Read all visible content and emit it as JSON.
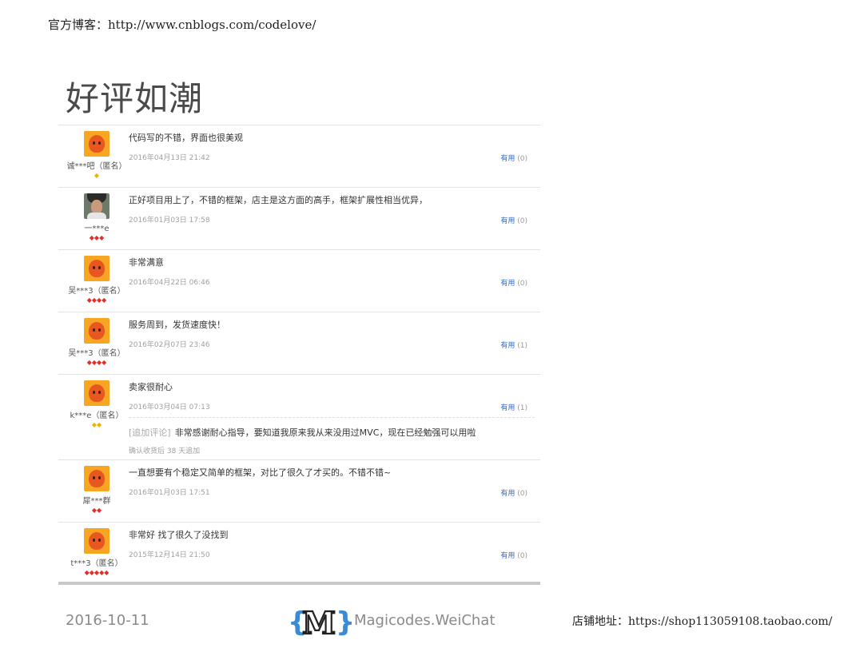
{
  "header": {
    "blog_label": "官方博客：http://www.cnblogs.com/codelove/"
  },
  "slide_title": "好评如潮",
  "reviews": [
    {
      "user": "诚***吧（匿名）",
      "badges": "◆",
      "badge_color": "gold",
      "text": "代码写的不错，界面也很美观",
      "date": "2016年04月13日 21:42",
      "useful_label": "有用",
      "useful_count": "(0)"
    },
    {
      "user": "一***e",
      "badges": "◆◆◆",
      "badge_color": "red",
      "text": "正好项目用上了，不错的框架，店主是这方面的高手，框架扩展性相当优异，",
      "date": "2016年01月03日 17:58",
      "useful_label": "有用",
      "useful_count": "(0)"
    },
    {
      "user": "吴***3（匿名）",
      "badges": "◆◆◆◆",
      "badge_color": "red",
      "text": "非常满意",
      "date": "2016年04月22日 06:46",
      "useful_label": "有用",
      "useful_count": "(0)"
    },
    {
      "user": "吴***3（匿名）",
      "badges": "◆◆◆◆",
      "badge_color": "red",
      "text": "服务周到，发货速度快！",
      "date": "2016年02月07日 23:46",
      "useful_label": "有用",
      "useful_count": "(1)"
    },
    {
      "user": "k***e（匿名）",
      "badges": "◆◆",
      "badge_color": "gold",
      "text": "卖家很耐心",
      "date": "2016年03月04日 07:13",
      "useful_label": "有用",
      "useful_count": "(1)",
      "followup_tag": "[追加评论]",
      "followup_text": "非常感谢耐心指导，要知道我原来我从来没用过MVC，现在已经勉强可以用啦",
      "followup_note": "确认收货后 38 天追加"
    },
    {
      "user": "犀***群",
      "badges": "◆◆",
      "badge_color": "red",
      "text": "一直想要有个稳定又简单的框架，对比了很久了才买的。不错不错~",
      "date": "2016年01月03日 17:51",
      "useful_label": "有用",
      "useful_count": "(0)"
    },
    {
      "user": "t***3（匿名）",
      "badges": "◆◆◆◆◆",
      "badge_color": "red",
      "text": "非常好 找了很久了没找到",
      "date": "2015年12月14日 21:50",
      "useful_label": "有用",
      "useful_count": "(0)"
    }
  ],
  "footer": {
    "date": "2016-10-11",
    "logo_letter": "M",
    "logo_text": "Magicodes.WeiChat",
    "shop_label": "店铺地址：https://shop113059108.taobao.com/"
  },
  "colors": {
    "link_blue": "#3366cc",
    "badge_red": "#e0302a",
    "badge_gold": "#e8b400",
    "avatar_orange": "#f6a623",
    "logo_blue": "#3a8ad6"
  }
}
